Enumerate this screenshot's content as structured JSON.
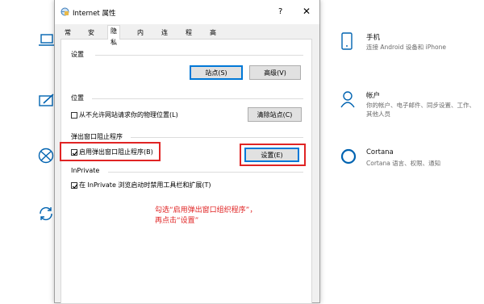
{
  "dialog": {
    "title": "Internet 属性",
    "help": "?",
    "close": "✕",
    "tabs": [
      "常规",
      "安全",
      "隐私",
      "内容",
      "连接",
      "程序",
      "高级"
    ],
    "active_tab_index": 2
  },
  "settings_section": {
    "label": "设置",
    "sites_button": "站点(S)",
    "advanced_button": "高级(V)"
  },
  "location_section": {
    "label": "位置",
    "checkbox_label": "从不允许网站请求你的物理位置(L)",
    "checkbox_checked": false,
    "clear_sites_button": "清除站点(C)"
  },
  "popup_section": {
    "label": "弹出窗口阻止程序",
    "checkbox_label": "启用弹出窗口阻止程序(B)",
    "checkbox_checked": true,
    "settings_button": "设置(E)"
  },
  "inprivate_section": {
    "label": "InPrivate",
    "checkbox_label": "在 InPrivate 浏览启动时禁用工具栏和扩展(T)",
    "checkbox_checked": true
  },
  "annotation": {
    "line1": "勾选“启用弹出窗口组织程序”，",
    "line2": "再点击“设置”",
    "color": "#e02424"
  },
  "background_settings": {
    "items": [
      {
        "icon": "phone-icon",
        "title": "手机",
        "description": "连接 Android 设备和 iPhone"
      },
      {
        "icon": "person-icon",
        "title": "帐户",
        "description": "你的帐户、电子邮件、同步设置、工作、其他人员"
      },
      {
        "icon": "cortana-icon",
        "title": "Cortana",
        "description": "Cortana 语言、权限、通知"
      }
    ],
    "accent_color": "#0063b1"
  }
}
